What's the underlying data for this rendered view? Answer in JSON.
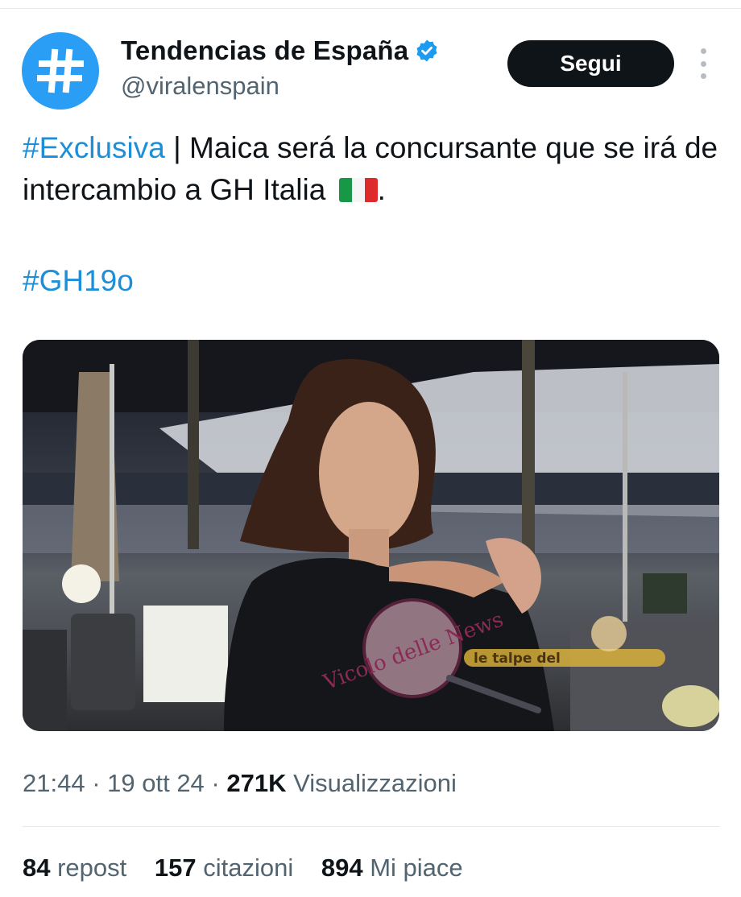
{
  "account": {
    "display_name": "Tendencias de España",
    "handle": "@viralenspain",
    "avatar_icon": "hashtag-icon",
    "avatar_color": "#2a9df4",
    "verified_icon": "verified-badge-icon"
  },
  "actions": {
    "follow_label": "Segui",
    "more_icon": "more-vertical-icon"
  },
  "tweet": {
    "hashtag_exclusive": "#Exclusiva",
    "body_text": " | Maica será la concursante que se irá de intercambio a GH Italia ",
    "flag_icon": "italy-flag-icon",
    "trailing_period": ".",
    "hashtag_show": "#GH19o"
  },
  "media": {
    "watermark_circle": "Vicolo delle News",
    "watermark_banner": "le talpe del"
  },
  "meta": {
    "time": "21:44",
    "separator": " · ",
    "date": "19 ott 24",
    "views_count": "271K",
    "views_label": " Visualizzazioni"
  },
  "stats": {
    "reposts_count": "84",
    "reposts_label": " repost",
    "quotes_count": "157",
    "quotes_label": " citazioni",
    "likes_count": "894",
    "likes_label": " Mi piace"
  },
  "colors": {
    "accent": "#1d8fd8",
    "text": "#0f1419",
    "muted": "#536471",
    "button_bg": "#0f1419"
  }
}
